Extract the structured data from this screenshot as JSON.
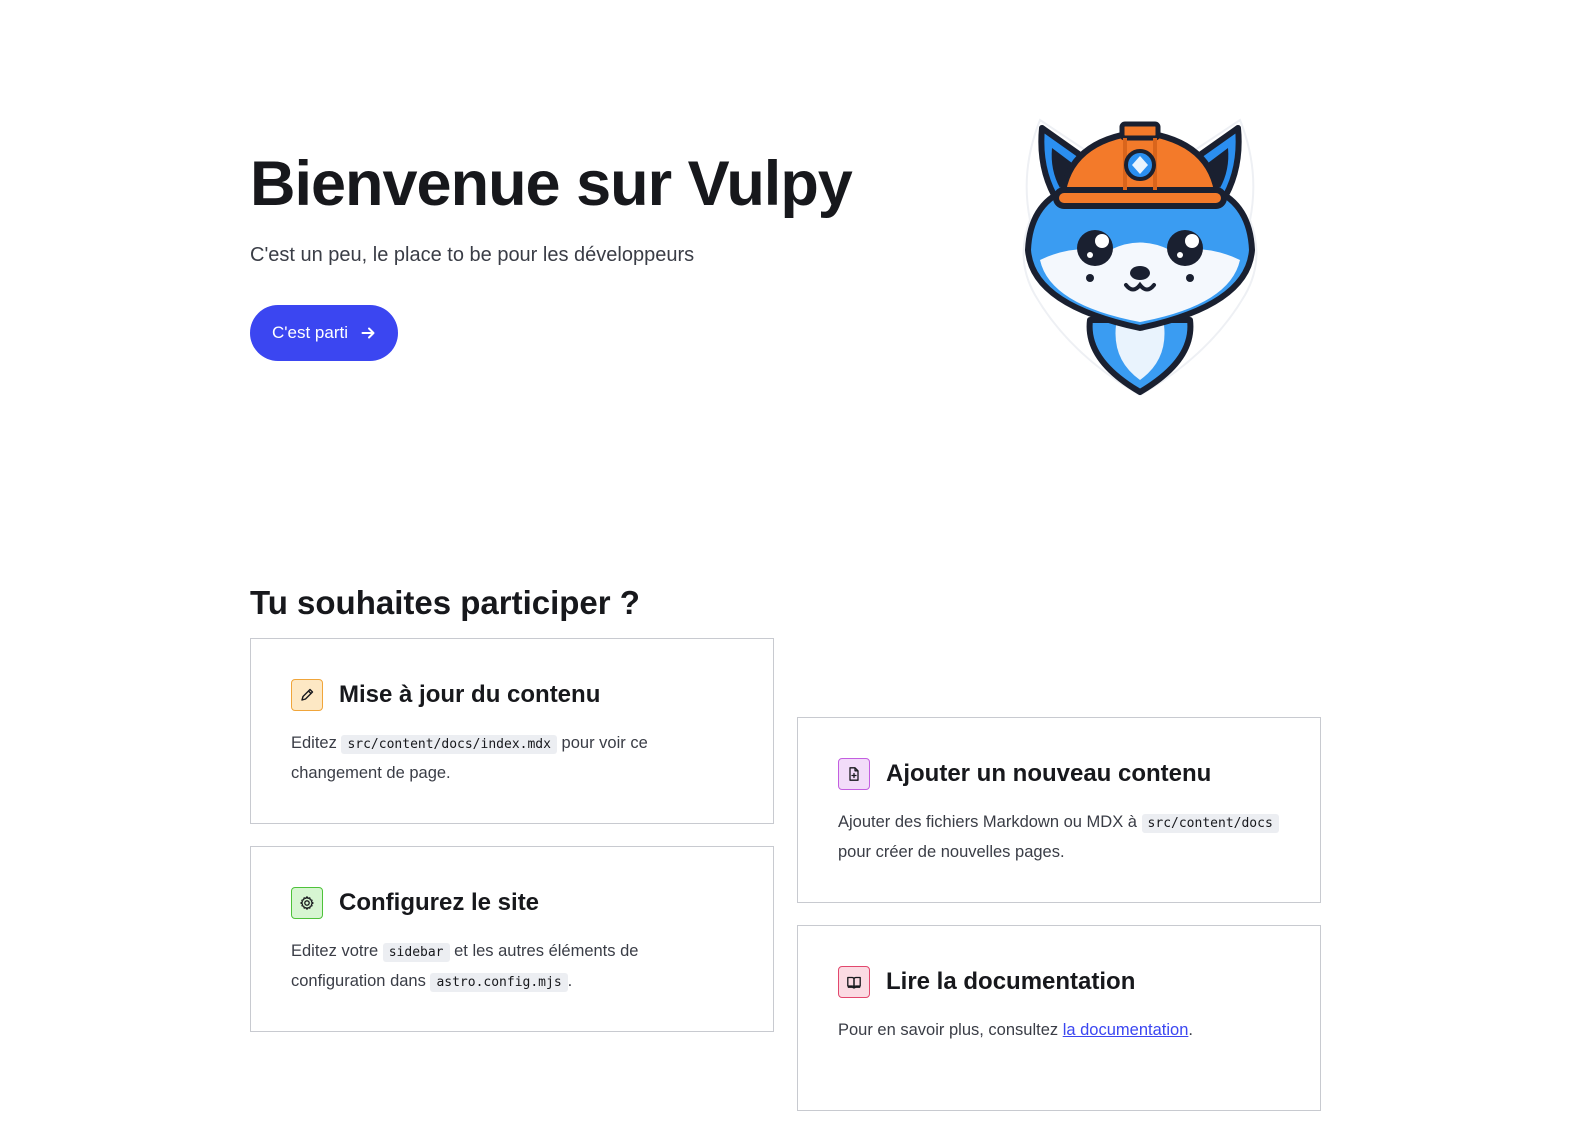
{
  "hero": {
    "title": "Bienvenue sur Vulpy",
    "tagline": "C'est un peu, le place to be pour les développeurs",
    "cta_label": "C'est parti",
    "mascot_alt": "Vulpy mascot"
  },
  "section": {
    "title": "Tu souhaites participer ?"
  },
  "cards": [
    {
      "title": "Mise à jour du contenu",
      "icon": "pencil-icon",
      "text_before": "Editez ",
      "code1": "src/content/docs/index.mdx",
      "text_after": " pour voir ce changement de page."
    },
    {
      "title": "Ajouter un nouveau contenu",
      "icon": "add-document-icon",
      "text_before": "Ajouter des fichiers Markdown ou MDX à ",
      "code1": "src/content/docs",
      "text_after": " pour créer de nouvelles pages."
    },
    {
      "title": "Configurez le site",
      "icon": "gear-icon",
      "text_before": "Editez votre ",
      "code1": "sidebar",
      "text_middle": " et les autres éléments de configuration dans ",
      "code2": "astro.config.mjs",
      "text_after": "."
    },
    {
      "title": "Lire la documentation",
      "icon": "open-book-icon",
      "text_before": "Pour en savoir plus, consultez ",
      "link_label": "la documentation",
      "text_after": "."
    }
  ],
  "colors": {
    "accent": "#3b46f1",
    "icon_orange": "#f0a53a",
    "icon_purple": "#c35ee0",
    "icon_green": "#4ec23a",
    "icon_red": "#e2476d"
  }
}
